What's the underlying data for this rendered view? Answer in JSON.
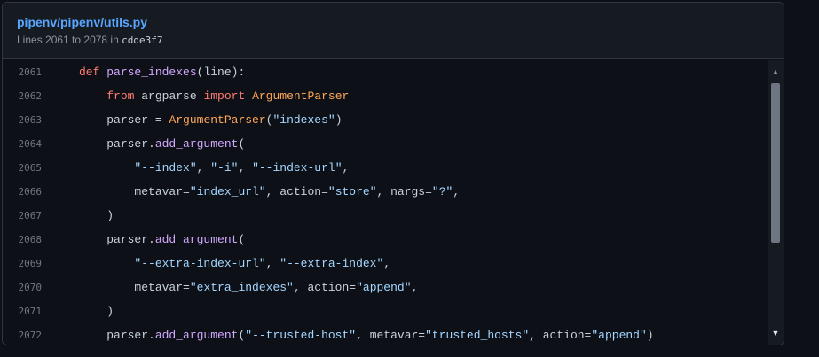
{
  "header": {
    "file_path": "pipenv/pipenv/utils.py",
    "lines_text": "Lines 2061 to 2078 in",
    "commit_sha": "cdde3f7"
  },
  "code": {
    "lines": [
      {
        "number": "2061",
        "indent": "",
        "tokens": [
          [
            "k",
            "def"
          ],
          [
            "t",
            " "
          ],
          [
            "f",
            "parse_indexes"
          ],
          [
            "t",
            "(line):"
          ]
        ]
      },
      {
        "number": "2062",
        "indent": "    ",
        "tokens": [
          [
            "k",
            "from"
          ],
          [
            "t",
            " argparse "
          ],
          [
            "k",
            "import"
          ],
          [
            "t",
            " "
          ],
          [
            "c",
            "ArgumentParser"
          ]
        ]
      },
      {
        "number": "2063",
        "indent": "    ",
        "tokens": [
          [
            "t",
            "parser = "
          ],
          [
            "c",
            "ArgumentParser"
          ],
          [
            "t",
            "("
          ],
          [
            "s",
            "\"indexes\""
          ],
          [
            "t",
            ")"
          ]
        ]
      },
      {
        "number": "2064",
        "indent": "    ",
        "tokens": [
          [
            "t",
            "parser."
          ],
          [
            "f",
            "add_argument"
          ],
          [
            "t",
            "("
          ]
        ]
      },
      {
        "number": "2065",
        "indent": "        ",
        "tokens": [
          [
            "s",
            "\"--index\""
          ],
          [
            "t",
            ", "
          ],
          [
            "s",
            "\"-i\""
          ],
          [
            "t",
            ", "
          ],
          [
            "s",
            "\"--index-url\""
          ],
          [
            "t",
            ","
          ]
        ]
      },
      {
        "number": "2066",
        "indent": "        ",
        "tokens": [
          [
            "t",
            "metavar="
          ],
          [
            "s",
            "\"index_url\""
          ],
          [
            "t",
            ", action="
          ],
          [
            "s",
            "\"store\""
          ],
          [
            "t",
            ", nargs="
          ],
          [
            "s",
            "\"?\""
          ],
          [
            "t",
            ","
          ]
        ]
      },
      {
        "number": "2067",
        "indent": "    ",
        "tokens": [
          [
            "t",
            ")"
          ]
        ]
      },
      {
        "number": "2068",
        "indent": "    ",
        "tokens": [
          [
            "t",
            "parser."
          ],
          [
            "f",
            "add_argument"
          ],
          [
            "t",
            "("
          ]
        ]
      },
      {
        "number": "2069",
        "indent": "        ",
        "tokens": [
          [
            "s",
            "\"--extra-index-url\""
          ],
          [
            "t",
            ", "
          ],
          [
            "s",
            "\"--extra-index\""
          ],
          [
            "t",
            ","
          ]
        ]
      },
      {
        "number": "2070",
        "indent": "        ",
        "tokens": [
          [
            "t",
            "metavar="
          ],
          [
            "s",
            "\"extra_indexes\""
          ],
          [
            "t",
            ", action="
          ],
          [
            "s",
            "\"append\""
          ],
          [
            "t",
            ","
          ]
        ]
      },
      {
        "number": "2071",
        "indent": "    ",
        "tokens": [
          [
            "t",
            ")"
          ]
        ]
      },
      {
        "number": "2072",
        "indent": "    ",
        "tokens": [
          [
            "t",
            "parser."
          ],
          [
            "f",
            "add_argument"
          ],
          [
            "t",
            "("
          ],
          [
            "s",
            "\"--trusted-host\""
          ],
          [
            "t",
            ", metavar="
          ],
          [
            "s",
            "\"trusted_hosts\""
          ],
          [
            "t",
            ", action="
          ],
          [
            "s",
            "\"append\""
          ],
          [
            "t",
            ")"
          ]
        ]
      }
    ]
  },
  "scrollbar": {
    "up_icon": "triangle-up-icon",
    "down_icon": "triangle-down-icon"
  },
  "colors": {
    "background": "#0d1117",
    "link": "#58a6ff",
    "keyword": "#ff7b72",
    "function": "#d2a8ff",
    "class": "#ffa657",
    "string": "#a5d6ff"
  }
}
